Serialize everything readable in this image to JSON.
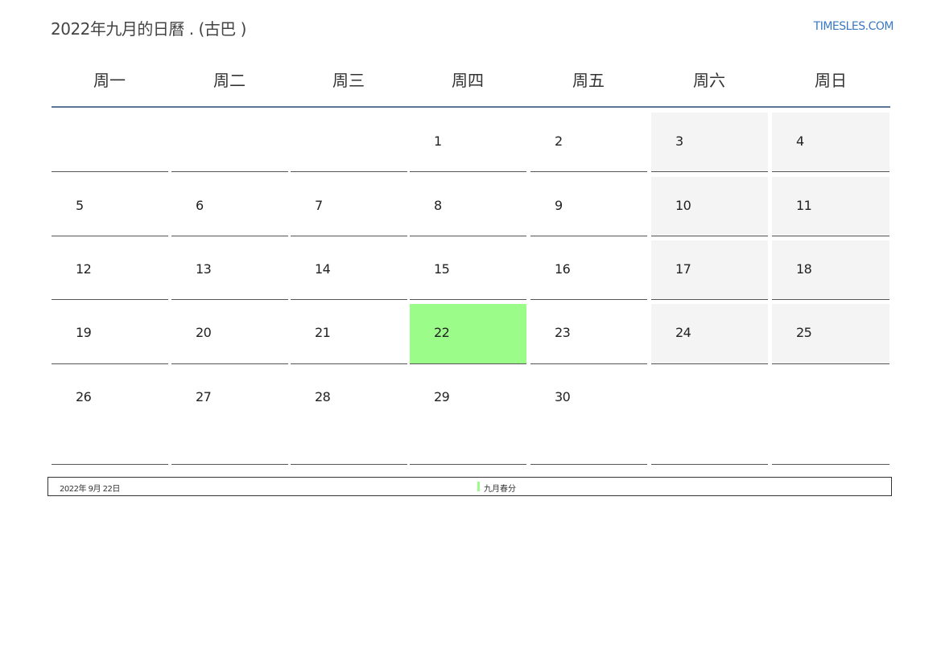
{
  "header": {
    "title": "2022年九月的日曆 . (古巴 )",
    "site": "TIMESLES.COM"
  },
  "weekdays": [
    "周一",
    "周二",
    "周三",
    "周四",
    "周五",
    "周六",
    "周日"
  ],
  "weeks": [
    [
      "",
      "",
      "",
      "1",
      "2",
      "3",
      "4"
    ],
    [
      "5",
      "6",
      "7",
      "8",
      "9",
      "10",
      "11"
    ],
    [
      "12",
      "13",
      "14",
      "15",
      "16",
      "17",
      "18"
    ],
    [
      "19",
      "20",
      "21",
      "22",
      "23",
      "24",
      "25"
    ],
    [
      "26",
      "27",
      "28",
      "29",
      "30",
      "",
      ""
    ]
  ],
  "holiday_day": "22",
  "holiday_color": "#9cfc8a",
  "weekend_color": "#f4f4f4",
  "legend": {
    "date": "2022年 9月 22日",
    "name": "九月春分"
  }
}
